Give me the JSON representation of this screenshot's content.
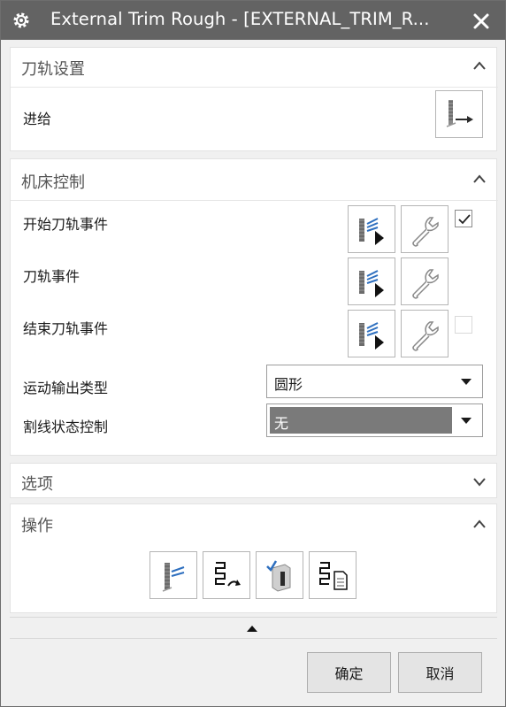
{
  "window": {
    "title": "External Trim Rough - [EXTERNAL_TRIM_R...",
    "title_icon": "gear-icon",
    "close_icon": "close-icon"
  },
  "path_settings": {
    "header": "刀轨设置",
    "collapsed": false,
    "feed_label": "进给"
  },
  "machine_control": {
    "header": "机床控制",
    "collapsed": false,
    "rows": [
      {
        "label": "开始刀轨事件",
        "checkbox_checked": true,
        "checkbox_enabled": true
      },
      {
        "label": "刀轨事件"
      },
      {
        "label": "结束刀轨事件",
        "checkbox_checked": false,
        "checkbox_enabled": false
      }
    ],
    "motion_output_label": "运动输出类型",
    "motion_output_value": "圆形",
    "cutline_label": "割线状态控制",
    "cutline_value": "无"
  },
  "options": {
    "header": "选项",
    "collapsed": true
  },
  "actions": {
    "header": "操作",
    "collapsed": false
  },
  "footer": {
    "ok_label": "确定",
    "cancel_label": "取消"
  },
  "colors": {
    "titlebar": "#636363",
    "selected_dropdown": "#7a7a7a",
    "accent_blue": "#2e6fbf"
  }
}
